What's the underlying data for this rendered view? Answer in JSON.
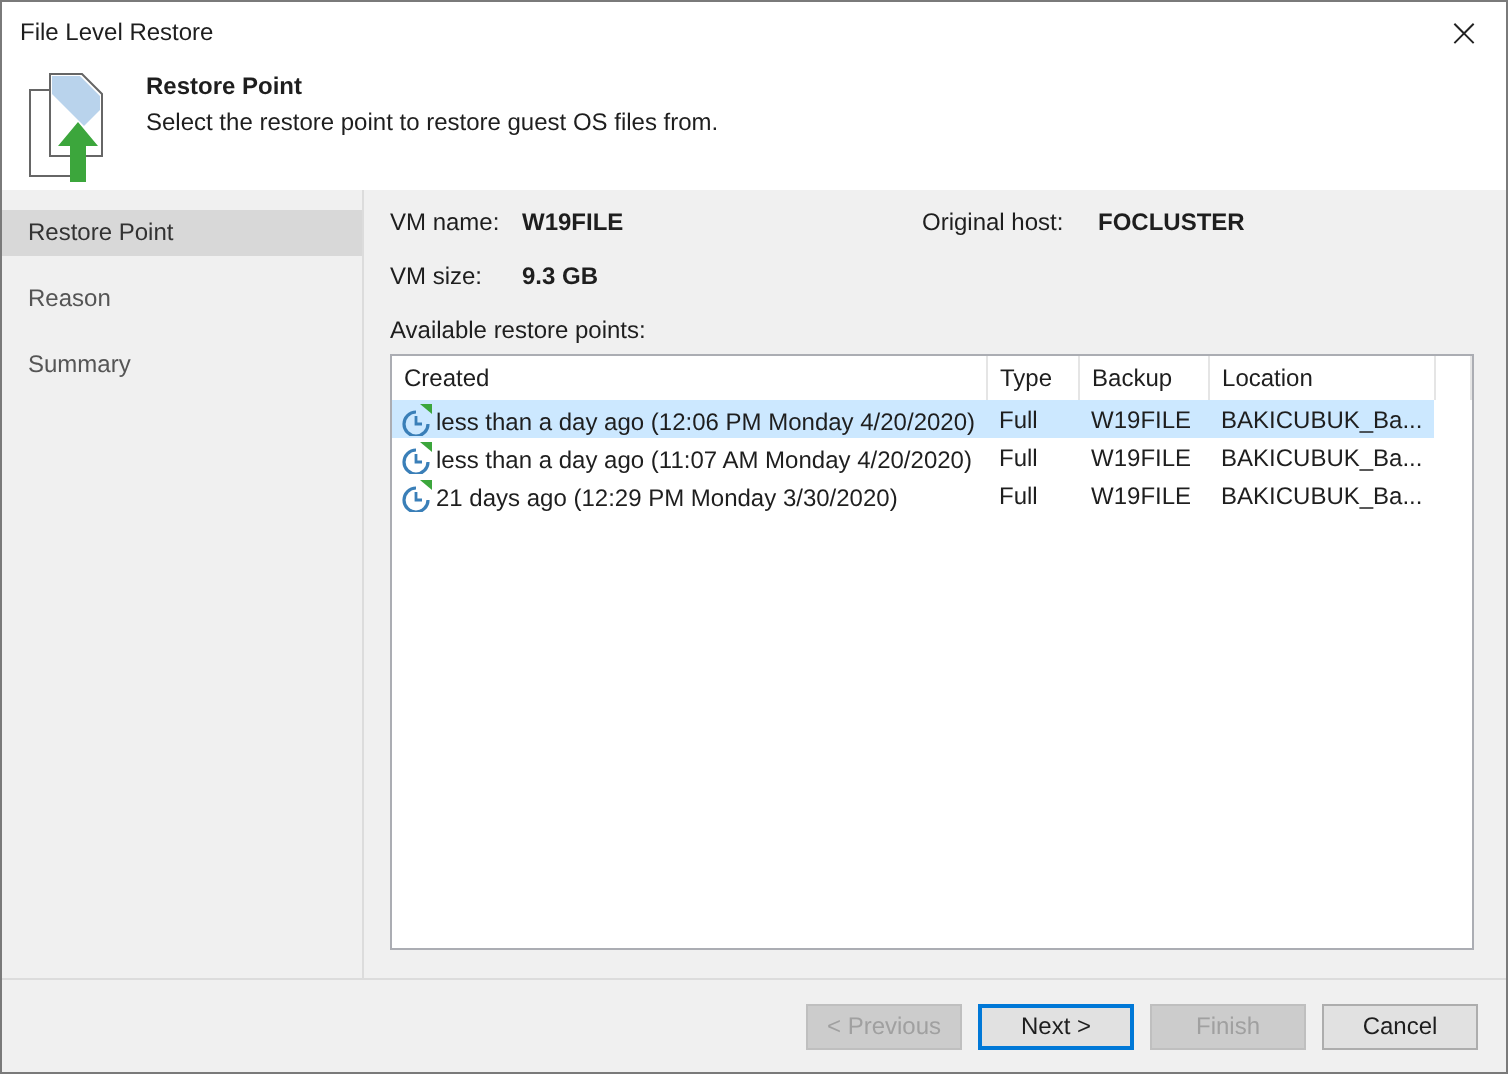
{
  "window": {
    "title": "File Level Restore",
    "close": "×"
  },
  "header": {
    "title": "Restore Point",
    "description": "Select the restore point to restore guest OS files from."
  },
  "sidebar": {
    "items": [
      {
        "label": "Restore Point",
        "selected": true
      },
      {
        "label": "Reason",
        "selected": false
      },
      {
        "label": "Summary",
        "selected": false
      }
    ]
  },
  "vm_info": {
    "name_label": "VM name:",
    "name": "W19FILE",
    "host_label": "Original host:",
    "host": "FOCLUSTER",
    "size_label": "VM size:",
    "size": "9.3 GB"
  },
  "table": {
    "label": "Available restore points:",
    "columns": [
      "Created",
      "Type",
      "Backup",
      "Location"
    ],
    "rows": [
      {
        "cells": [
          "less than a day ago (12:06 PM Monday 4/20/2020)",
          "Full",
          "W19FILE",
          "BAKICUBUK_Ba..."
        ],
        "selected": true
      },
      {
        "cells": [
          "less than a day ago (11:07 AM Monday 4/20/2020)",
          "Full",
          "W19FILE",
          "BAKICUBUK_Ba..."
        ],
        "selected": false
      },
      {
        "cells": [
          "21 days ago (12:29 PM Monday 3/30/2020)",
          "Full",
          "W19FILE",
          "BAKICUBUK_Ba..."
        ],
        "selected": false
      }
    ]
  },
  "buttons": [
    {
      "label": "< Previous",
      "disabled": true,
      "default": false
    },
    {
      "label": "Next >",
      "disabled": false,
      "default": true
    },
    {
      "label": "Finish",
      "disabled": true,
      "default": false
    },
    {
      "label": "Cancel",
      "disabled": false,
      "default": false
    }
  ]
}
